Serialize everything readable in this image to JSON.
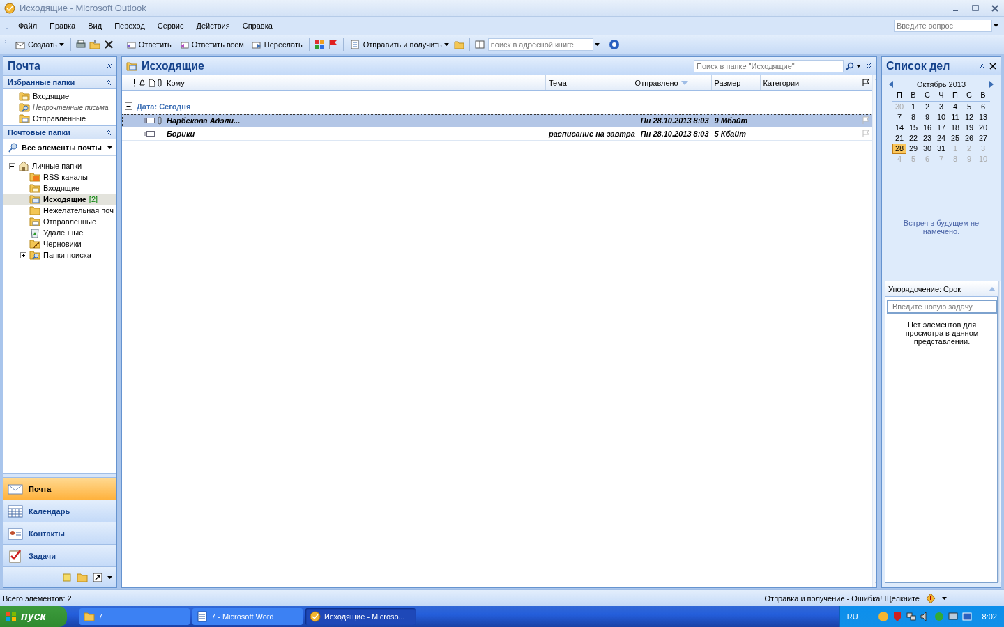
{
  "window": {
    "title": "Исходящие - Microsoft Outlook"
  },
  "menu": [
    "Файл",
    "Правка",
    "Вид",
    "Переход",
    "Сервис",
    "Действия",
    "Справка"
  ],
  "help_search": {
    "placeholder": "Введите вопрос"
  },
  "toolbar": {
    "create": "Создать",
    "reply": "Ответить",
    "reply_all": "Ответить всем",
    "forward": "Переслать",
    "send_receive": "Отправить и получить",
    "address_search": {
      "placeholder": "поиск в адресной книге"
    }
  },
  "nav_pane": {
    "title": "Почта",
    "favorites": {
      "title": "Избранные папки",
      "items": [
        {
          "label": "Входящие",
          "kind": "inbox",
          "dimmed": false
        },
        {
          "label": "Непрочтенные письма",
          "kind": "search",
          "dimmed": true
        },
        {
          "label": "Отправленные",
          "kind": "sent",
          "dimmed": false
        }
      ]
    },
    "mail_folders": {
      "title": "Почтовые папки",
      "view": "Все элементы почты"
    },
    "tree": [
      {
        "label": "Личные папки",
        "kind": "personal",
        "expanded": true,
        "selected": false,
        "children": [
          {
            "label": "RSS-каналы",
            "kind": "rss",
            "selected": false
          },
          {
            "label": "Входящие",
            "kind": "inbox",
            "selected": false
          },
          {
            "label": "Исходящие",
            "kind": "outbox",
            "selected": true,
            "count": "[2]"
          },
          {
            "label": "Нежелательная поч",
            "kind": "junk",
            "selected": false
          },
          {
            "label": "Отправленные",
            "kind": "sent",
            "selected": false
          },
          {
            "label": "Удаленные",
            "kind": "deleted",
            "selected": false
          },
          {
            "label": "Черновики",
            "kind": "drafts",
            "selected": false
          },
          {
            "label": "Папки поиска",
            "kind": "search",
            "selected": false,
            "expanded": false
          }
        ]
      }
    ],
    "buttons": [
      {
        "label": "Почта",
        "kind": "mail",
        "selected": true
      },
      {
        "label": "Календарь",
        "kind": "calendar",
        "selected": false
      },
      {
        "label": "Контакты",
        "kind": "contacts",
        "selected": false
      },
      {
        "label": "Задачи",
        "kind": "tasks",
        "selected": false
      }
    ]
  },
  "folder": {
    "title": "Исходящие",
    "search": {
      "placeholder": "Поиск в папке \"Исходящие\""
    },
    "columns": [
      "Кому",
      "Тема",
      "Отправлено",
      "Размер",
      "Категории"
    ],
    "group": "Дата: Сегодня",
    "rows": [
      {
        "to": "Нарбекова Адэли...",
        "subject": "",
        "sent": "Пн 28.10.2013 8:03",
        "size": "9 Мбайт",
        "attachment": true,
        "selected": true
      },
      {
        "to": "Борики",
        "subject": "расписание на завтра",
        "sent": "Пн 28.10.2013 8:03",
        "size": "5 Кбайт",
        "attachment": false,
        "selected": false
      }
    ]
  },
  "todo_bar": {
    "title": "Список дел",
    "calendar": {
      "month": "Октябрь 2013",
      "weekdays": [
        "П",
        "В",
        "С",
        "Ч",
        "П",
        "С",
        "В"
      ],
      "weeks": [
        [
          {
            "day": "30",
            "other": true,
            "selected": false
          },
          {
            "day": "1",
            "other": false,
            "selected": false
          },
          {
            "day": "2",
            "other": false,
            "selected": false
          },
          {
            "day": "3",
            "other": false,
            "selected": false
          },
          {
            "day": "4",
            "other": false,
            "selected": false
          },
          {
            "day": "5",
            "other": false,
            "selected": false
          },
          {
            "day": "6",
            "other": false,
            "selected": false
          }
        ],
        [
          {
            "day": "7",
            "other": false,
            "selected": false
          },
          {
            "day": "8",
            "other": false,
            "selected": false
          },
          {
            "day": "9",
            "other": false,
            "selected": false
          },
          {
            "day": "10",
            "other": false,
            "selected": false
          },
          {
            "day": "11",
            "other": false,
            "selected": false
          },
          {
            "day": "12",
            "other": false,
            "selected": false
          },
          {
            "day": "13",
            "other": false,
            "selected": false
          }
        ],
        [
          {
            "day": "14",
            "other": false,
            "selected": false
          },
          {
            "day": "15",
            "other": false,
            "selected": false
          },
          {
            "day": "16",
            "other": false,
            "selected": false
          },
          {
            "day": "17",
            "other": false,
            "selected": false
          },
          {
            "day": "18",
            "other": false,
            "selected": false
          },
          {
            "day": "19",
            "other": false,
            "selected": false
          },
          {
            "day": "20",
            "other": false,
            "selected": false
          }
        ],
        [
          {
            "day": "21",
            "other": false,
            "selected": false
          },
          {
            "day": "22",
            "other": false,
            "selected": false
          },
          {
            "day": "23",
            "other": false,
            "selected": false
          },
          {
            "day": "24",
            "other": false,
            "selected": false
          },
          {
            "day": "25",
            "other": false,
            "selected": false
          },
          {
            "day": "26",
            "other": false,
            "selected": false
          },
          {
            "day": "27",
            "other": false,
            "selected": false
          }
        ],
        [
          {
            "day": "28",
            "other": false,
            "selected": true
          },
          {
            "day": "29",
            "other": false,
            "selected": false
          },
          {
            "day": "30",
            "other": false,
            "selected": false
          },
          {
            "day": "31",
            "other": false,
            "selected": false
          },
          {
            "day": "1",
            "other": true,
            "selected": false
          },
          {
            "day": "2",
            "other": true,
            "selected": false
          },
          {
            "day": "3",
            "other": true,
            "selected": false
          }
        ],
        [
          {
            "day": "4",
            "other": true,
            "selected": false
          },
          {
            "day": "5",
            "other": true,
            "selected": false
          },
          {
            "day": "6",
            "other": true,
            "selected": false
          },
          {
            "day": "7",
            "other": true,
            "selected": false
          },
          {
            "day": "8",
            "other": true,
            "selected": false
          },
          {
            "day": "9",
            "other": true,
            "selected": false
          },
          {
            "day": "10",
            "other": true,
            "selected": false
          }
        ]
      ]
    },
    "appointments_note": "Встреч в будущем не намечено.",
    "tasks": {
      "arrange": "Упорядочение: Срок",
      "new_task": {
        "placeholder": "Введите новую задачу"
      },
      "empty": "Нет элементов для просмотра в данном представлении."
    }
  },
  "status_bar": {
    "left": "Всего элементов: 2",
    "right": "Отправка и получение - Ошибка! Щелкните"
  },
  "taskbar": {
    "start": "пуск",
    "items": [
      {
        "label": "7",
        "kind": "folder",
        "selected": false
      },
      {
        "label": "7 - Microsoft Word",
        "kind": "word",
        "selected": false
      },
      {
        "label": "Исходящие - Microso...",
        "kind": "outlook",
        "selected": true
      }
    ],
    "language": "RU",
    "clock": "8:02"
  }
}
